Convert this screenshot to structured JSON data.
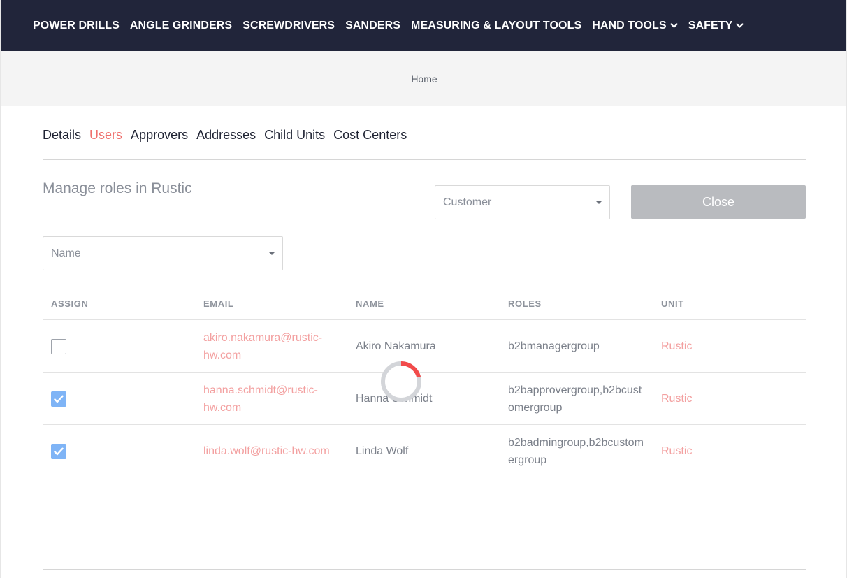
{
  "nav": {
    "items": [
      {
        "label": "POWER DRILLS"
      },
      {
        "label": "ANGLE GRINDERS"
      },
      {
        "label": "SCREWDRIVERS"
      },
      {
        "label": "SANDERS"
      },
      {
        "label": "MEASURING & LAYOUT TOOLS"
      },
      {
        "label": "HAND TOOLS"
      },
      {
        "label": "SAFETY"
      }
    ]
  },
  "breadcrumb": {
    "home": "Home"
  },
  "tabs": [
    {
      "label": "Details"
    },
    {
      "label": "Users"
    },
    {
      "label": "Approvers"
    },
    {
      "label": "Addresses"
    },
    {
      "label": "Child Units"
    },
    {
      "label": "Cost Centers"
    }
  ],
  "active_tab": "Users",
  "page": {
    "title": "Manage roles in Rustic",
    "role_filter": {
      "value": "Customer"
    },
    "close_label": "Close",
    "sort_select": {
      "value": "Name"
    }
  },
  "table": {
    "headers": {
      "assign": "ASSIGN",
      "email": "EMAIL",
      "name": "NAME",
      "roles": "ROLES",
      "unit": "UNIT"
    },
    "rows": [
      {
        "assigned": false,
        "email": "akiro.nakamura@rustic-hw.com",
        "name": "Akiro Nakamura",
        "roles": "b2bmanagergroup",
        "unit": "Rustic"
      },
      {
        "assigned": true,
        "email": "hanna.schmidt@rustic-hw.com",
        "name": "Hanna Schmidt",
        "roles": "b2bapprovergroup,b2bcustomergroup",
        "unit": "Rustic"
      },
      {
        "assigned": true,
        "email": "linda.wolf@rustic-hw.com",
        "name": "Linda Wolf",
        "roles": "b2badmingroup,b2bcustomergroup",
        "unit": "Rustic"
      }
    ]
  },
  "colors": {
    "nav_bg": "#21253a",
    "accent": "#ef6f6c",
    "link": "#f3a0a0",
    "checkbox_checked": "#7fb4f6",
    "button_disabled": "#b9bbbf"
  },
  "icons": {
    "dropdown": "chevron-down-icon",
    "select_caret": "caret-down-icon",
    "check": "check-icon",
    "loading": "spinner-icon"
  }
}
